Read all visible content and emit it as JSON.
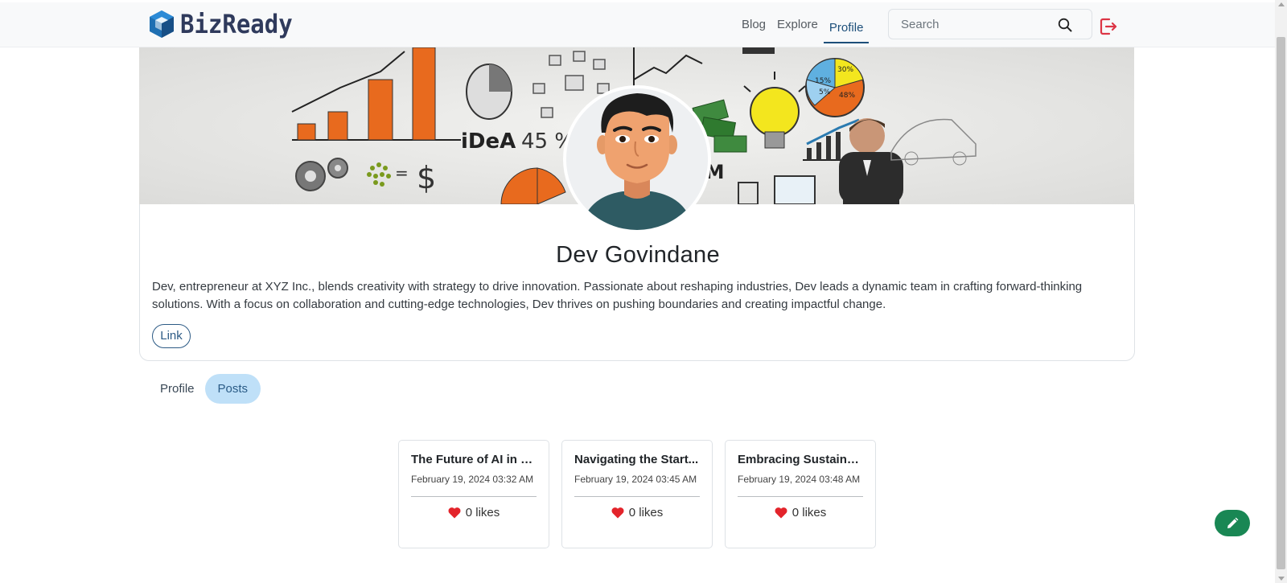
{
  "navbar": {
    "brand_name": "BizReady",
    "links": [
      {
        "label": "Blog"
      },
      {
        "label": "Explore"
      },
      {
        "label": "Profile",
        "active": true
      }
    ],
    "search": {
      "placeholder": "Search",
      "value": ""
    },
    "icons": {
      "search": "search-icon",
      "logout": "logout-icon"
    },
    "logout_color": "#dc3545"
  },
  "profile": {
    "name": "Dev Govindane",
    "bio": "Dev, entrepreneur at XYZ Inc., blends creativity with strategy to drive innovation. Passionate about reshaping industries, Dev leads a dynamic team in crafting forward-thinking solutions. With a focus on collaboration and cutting-edge technologies, Dev thrives on pushing boundaries and creating impactful change.",
    "link_label": "Link",
    "banner_text": {
      "idea": "iDeA",
      "percent": "45 %",
      "pie_30": "30%",
      "pie_15": "15%",
      "pie_48": "48%",
      "pie_5": "5%",
      "team_fragment": "AM"
    }
  },
  "tabs": [
    {
      "label": "Profile",
      "active": false
    },
    {
      "label": "Posts",
      "active": true
    }
  ],
  "posts": [
    {
      "title": "The Future of AI in B...",
      "date": "February 19, 2024 03:32 AM",
      "likes": "0 likes"
    },
    {
      "title": "Navigating the Start...",
      "date": "February 19, 2024 03:45 AM",
      "likes": "0 likes"
    },
    {
      "title": "Embracing Sustainab...",
      "date": "February 19, 2024 03:48 AM",
      "likes": "0 likes"
    }
  ],
  "fab": {
    "icon": "pencil-icon",
    "color": "#198754"
  },
  "colors": {
    "accent": "#1d4f7a",
    "tab_active_bg": "#bfe0f8",
    "heart": "#e3242b"
  }
}
